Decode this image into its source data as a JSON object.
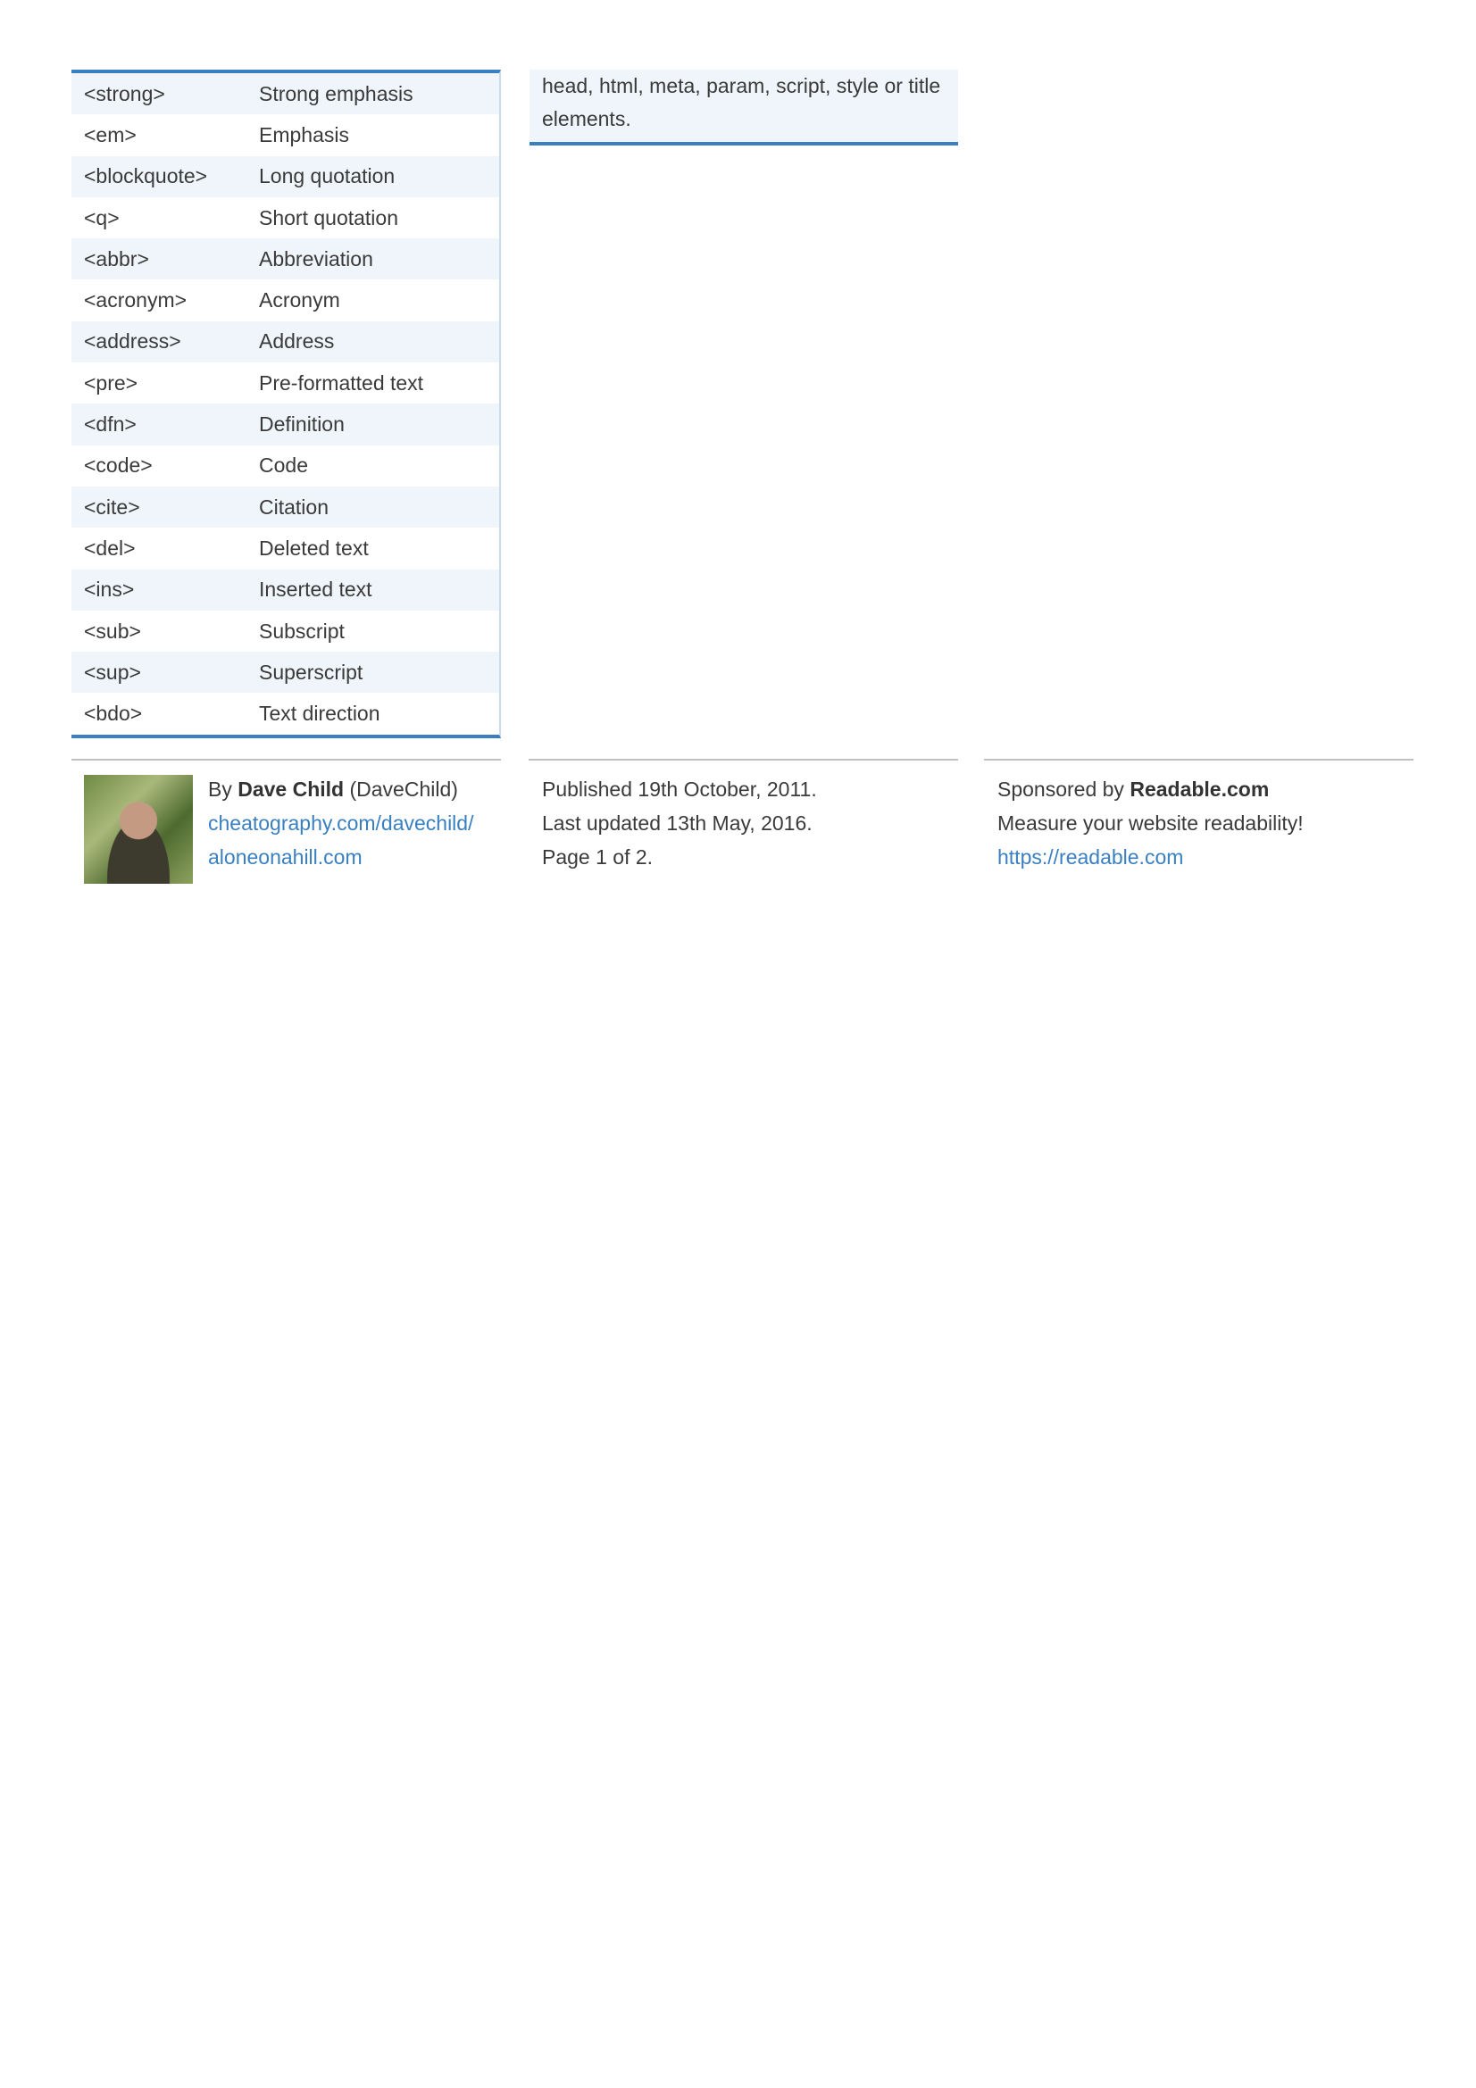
{
  "tags_table": [
    {
      "tag": "<strong>",
      "description": "Strong emphasis"
    },
    {
      "tag": "<em>",
      "description": "Emphasis"
    },
    {
      "tag": "<blockquote>",
      "description": "Long quotation"
    },
    {
      "tag": "<q>",
      "description": "Short quotation"
    },
    {
      "tag": "<abbr>",
      "description": "Abbreviation"
    },
    {
      "tag": "<acronym>",
      "description": "Acronym"
    },
    {
      "tag": "<address>",
      "description": "Address"
    },
    {
      "tag": "<pre>",
      "description": "Pre-formatted text"
    },
    {
      "tag": "<dfn>",
      "description": "Definition"
    },
    {
      "tag": "<code>",
      "description": "Code"
    },
    {
      "tag": "<cite>",
      "description": "Citation"
    },
    {
      "tag": "<del>",
      "description": "Deleted text"
    },
    {
      "tag": "<ins>",
      "description": "Inserted text"
    },
    {
      "tag": "<sub>",
      "description": "Subscript"
    },
    {
      "tag": "<sup>",
      "description": "Superscript"
    },
    {
      "tag": "<bdo>",
      "description": "Text direction"
    }
  ],
  "note": {
    "line1": "head, html, meta, param, script, style or title",
    "line2": "elements."
  },
  "footer": {
    "author": {
      "by_prefix": "By ",
      "name": "Dave Child",
      "handle": " (DaveChild)",
      "profile_link": "cheatography.com/davechild/",
      "website_link": "aloneonahill.com"
    },
    "published": {
      "published": "Published 19th October, 2011.",
      "updated": "Last updated 13th May, 2016.",
      "page": "Page 1 of 2."
    },
    "sponsor": {
      "prefix": "Sponsored by ",
      "name": "Readable.com",
      "tagline": "Measure your website readability!",
      "link": "https://readable.com"
    }
  },
  "colors": {
    "accent": "#3a80c0",
    "row_alt": "#eff5fa",
    "text": "#3a3a3a"
  }
}
